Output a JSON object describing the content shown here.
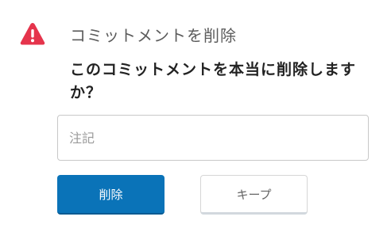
{
  "dialog": {
    "title": "コミットメントを削除",
    "question": "このコミットメントを本当に削除しますか？",
    "note_placeholder": "注記",
    "note_value": "",
    "delete_label": "削除",
    "keep_label": "キープ",
    "icon": "warning-triangle-icon",
    "colors": {
      "warning": "#e5344c",
      "primary": "#0a73b8",
      "keep_border": "#d2d8de"
    }
  }
}
